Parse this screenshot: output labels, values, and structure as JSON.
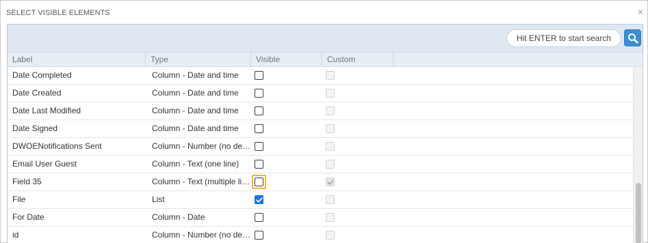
{
  "dialog": {
    "title": "SELECT VISIBLE ELEMENTS",
    "close_glyph": "×"
  },
  "search": {
    "placeholder": "Hit ENTER to start search",
    "button_icon": "search-icon"
  },
  "columns": {
    "label": "Label",
    "type": "Type",
    "visible": "Visible",
    "custom": "Custom"
  },
  "rows": [
    {
      "label": "Date Completed",
      "type": "Column - Date and time",
      "visible": false,
      "custom": false
    },
    {
      "label": "Date Created",
      "type": "Column - Date and time",
      "visible": false,
      "custom": false
    },
    {
      "label": "Date Last Modified",
      "type": "Column - Date and time",
      "visible": false,
      "custom": false
    },
    {
      "label": "Date Signed",
      "type": "Column - Date and time",
      "visible": false,
      "custom": false
    },
    {
      "label": "DWOENotifications Sent",
      "type": "Column - Number (no deci...",
      "visible": false,
      "custom": false
    },
    {
      "label": "Email User Guest",
      "type": "Column - Text (one line)",
      "visible": false,
      "custom": false
    },
    {
      "label": "Field 35",
      "type": "Column - Text (multiple lin...",
      "visible": false,
      "custom": true,
      "focused": true
    },
    {
      "label": "File",
      "type": "List",
      "visible": true,
      "custom": false
    },
    {
      "label": "For Date",
      "type": "Column - Date",
      "visible": false,
      "custom": false
    },
    {
      "label": "id",
      "type": "Column - Number (no deci...",
      "visible": false,
      "custom": false
    }
  ],
  "colors": {
    "accent": "#3d8ed3",
    "checkbox_checked": "#1a73e8",
    "focus_ring": "#f0b429",
    "toolbar_bg": "#dfe8f1"
  }
}
